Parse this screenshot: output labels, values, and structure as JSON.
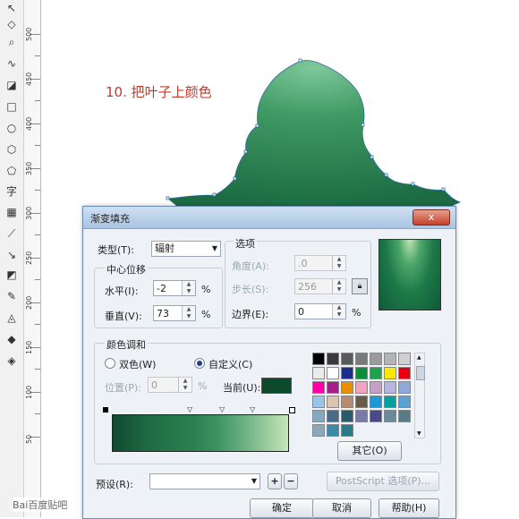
{
  "caption": "10. 把叶子上颜色",
  "toolbox": {
    "icons": [
      "pick-icon",
      "shape-icon",
      "crop-icon",
      "zoom-icon",
      "freehand-icon",
      "smart-fill-icon",
      "rectangle-icon",
      "ellipse-icon",
      "polygon-icon",
      "basic-shapes-icon",
      "text-icon",
      "table-icon",
      "dimension-icon",
      "connector-icon",
      "blend-icon",
      "eyedropper-icon",
      "outline-icon",
      "fill-icon",
      "interactive-fill-icon"
    ],
    "text_tool_glyph": "字"
  },
  "ruler": {
    "labels": [
      "500",
      "450",
      "400",
      "350",
      "300",
      "250",
      "200",
      "150",
      "100",
      "50"
    ]
  },
  "dialog": {
    "title": "渐变填充",
    "close_label": "x",
    "type_label": "类型(T):",
    "type_value": "辐射",
    "center_group_label": "中心位移",
    "horizontal_label": "水平(I):",
    "horizontal_value": "-2",
    "vertical_label": "垂直(V):",
    "vertical_value": "73",
    "percent": "%",
    "options_label": "选项",
    "angle_label": "角度(A):",
    "angle_value": ".0",
    "steps_label": "步长(S):",
    "steps_value": "256",
    "edge_label": "边界(E):",
    "edge_value": "0",
    "color_blend_label": "颜色调和",
    "two_color_label": "双色(W)",
    "custom_label": "自定义(C)",
    "position_label": "位置(P):",
    "position_value": "0",
    "current_label": "当前(U):",
    "other_button": "其它(O)",
    "preset_label": "预设(R):",
    "postscript_button": "PostScript 选项(P)...",
    "ok_button": "确定",
    "cancel_button": "取消",
    "help_button": "帮助(H)",
    "add_preset": "+",
    "remove_preset": "−",
    "current_color": "#0d4a2b"
  },
  "palette_colors": [
    "#000000",
    "#3a3a3a",
    "#5a5a5a",
    "#7a7a7a",
    "#9a9a9a",
    "#b5b5b5",
    "#d0d0d0",
    "#ebebeb",
    "#ffffff",
    "#1a2f8c",
    "#0a8e3a",
    "#1aa34a",
    "#ffe800",
    "#e60012",
    "#ff00a8",
    "#a51f8a",
    "#e89000",
    "#f2a5c0",
    "#c7a0c8",
    "#b5b5e0",
    "#8fa8d8",
    "#9ac5ea",
    "#d9c5b0",
    "#b58c70",
    "#6a5a4a",
    "#1a98d8",
    "#00a0a0",
    "#5aa0d0",
    "#84a8c4",
    "#4a6a8a",
    "#2a5a6a",
    "#7a7aaa",
    "#4a4a8a",
    "#6a8a9a",
    "#5a7a8a",
    "#8aaaba",
    "#3a8aaa",
    "#2a7a8a"
  ],
  "watermark": "Bai百度贴吧"
}
